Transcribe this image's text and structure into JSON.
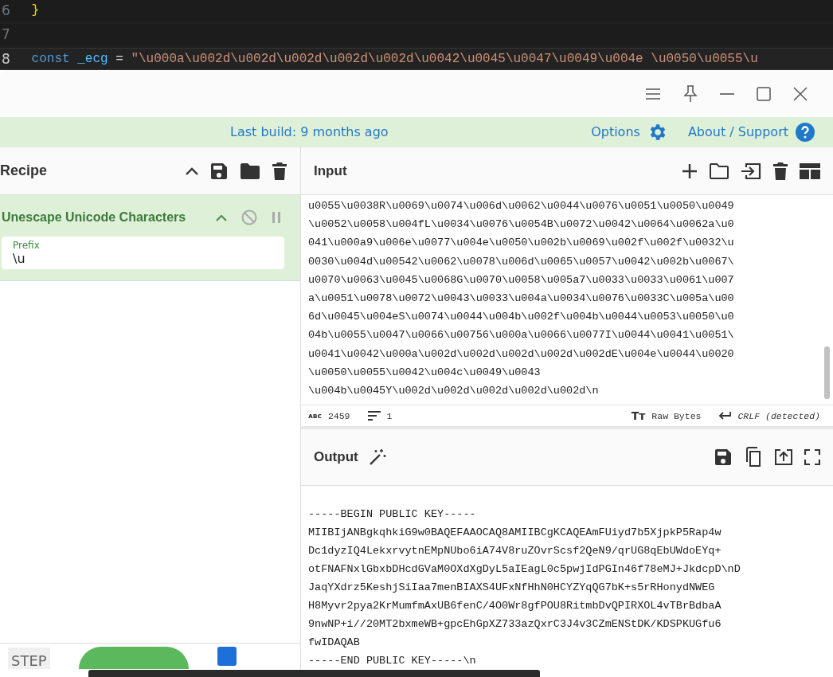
{
  "editor": {
    "lines": [
      {
        "number": "6",
        "code": [
          {
            "kind": "brace",
            "text": "}"
          }
        ],
        "current": false
      },
      {
        "number": "7",
        "current": false
      },
      {
        "number": "8",
        "code": [
          {
            "kind": "keyword",
            "text": "const"
          },
          {
            "kind": "name",
            "text": "_ecg"
          },
          {
            "kind": "plain",
            "text": "="
          },
          {
            "kind": "string",
            "text": "\"\\u000a\\u002d\\u002d\\u002d\\u002d\\u002d\\u0042\\u0045\\u0047\\u0049\\u004e \\u0050\\u0055\\u"
          }
        ],
        "current": true
      }
    ]
  },
  "banner": {
    "build": "Last build: 9 months ago",
    "options": "Options",
    "about": "About / Support"
  },
  "recipe": {
    "title": "Recipe",
    "operations": [
      {
        "name": "Unescape Unicode Characters",
        "disabled": false,
        "paused": false,
        "fields": [
          {
            "label": "Prefix",
            "value": "\\u"
          }
        ]
      }
    ],
    "step": "STEP",
    "auto_bake": true
  },
  "input": {
    "title": "Input",
    "lines": [
      "u0055\\u0038R\\u0069\\u0074\\u006d\\u0062\\u0044\\u0076\\u0051\\u0050\\u0049",
      "\\u0052\\u0058\\u004fL\\u0034\\u0076\\u0054B\\u0072\\u0042\\u0064\\u0062a\\u0",
      "041\\u000a9\\u006e\\u0077\\u004e\\u0050\\u002b\\u0069\\u002f\\u002f\\u0032\\u",
      "0030\\u004d\\u00542\\u0062\\u0078\\u006d\\u0065\\u0057\\u0042\\u002b\\u0067\\",
      "u0070\\u0063\\u0045\\u0068G\\u0070\\u0058\\u005a7\\u0033\\u0033\\u0061\\u007",
      "a\\u0051\\u0078\\u0072\\u0043\\u0033\\u004a\\u0034\\u0076\\u0033C\\u005a\\u00",
      "6d\\u0045\\u004eS\\u0074\\u0044\\u004b\\u002f\\u004b\\u0044\\u0053\\u0050\\u0",
      "04b\\u0055\\u0047\\u0066\\u00756\\u000a\\u0066\\u0077I\\u0044\\u0041\\u0051\\",
      "u0041\\u0042\\u000a\\u002d\\u002d\\u002d\\u002d\\u002dE\\u004e\\u0044\\u0020",
      "\\u0050\\u0055\\u0042\\u004c\\u0049\\u0043",
      "\\u004b\\u0045Y\\u002d\\u002d\\u002d\\u002d\\u002d\\n"
    ],
    "length_icon": "ᴀʙᴄ",
    "encoding_icon": "Tт",
    "length": "2459",
    "line_count": "1",
    "encoding": "Raw Bytes",
    "eol": "CRLF (detected)"
  },
  "output": {
    "title": "Output",
    "lines": [
      "-----BEGIN PUBLIC KEY-----",
      "MIIBIjANBgkqhkiG9w0BAQEFAAOCAQ8AMIIBCgKCAQEAmFUiyd7b5XjpkP5Rap4w",
      "Dc1dyzIQ4LekxrvytnEMpNUbo6iA74V8ruZOvrScsf2QeN9/qrUG8qEbUWdoEYq+",
      "otFNAFNxlGbxbDHcdGVaM0OXdXgDyL5aIEagL0c5pwjIdPGIn46f78eMJ+JkdcpD\\nD",
      "JaqYXdrz5KeshjSiIaa7menBIAXS4UFxNfHhN0HCYZYqQG7bK+s5rRHonydNWEG",
      "H8Myvr2pya2KrMumfmAxUB6fenC/4O0Wr8gfPOU8RitmbDvQPIRXOL4vTBrBdbaA",
      "9nwNP+i//20MT2bxmeWB+gpcEhGpXZ733azQxrC3J4v3CZmENStDK/KDSPKUGfu6",
      "fwIDAQAB",
      "-----END PUBLIC KEY-----\\n"
    ]
  }
}
